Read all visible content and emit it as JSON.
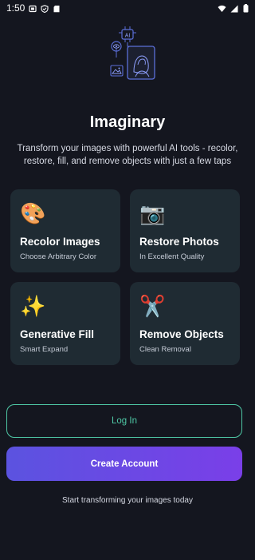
{
  "status_bar": {
    "time": "1:50",
    "icons": [
      "screen-record-icon",
      "vpn-shield-icon",
      "sd-card-icon",
      "wifi-icon",
      "signal-icon",
      "battery-icon"
    ]
  },
  "hero": {
    "badge_text": "AI",
    "icon": "ai-portrait-illustration-icon"
  },
  "app_title": "Imaginary",
  "subtitle": "Transform your images with powerful AI tools - recolor, restore, fill, and remove objects with just a few taps",
  "features": [
    {
      "emoji": "🎨",
      "icon": "palette-icon",
      "title": "Recolor Images",
      "subtitle": "Choose Arbitrary Color"
    },
    {
      "emoji": "📷",
      "icon": "camera-icon",
      "title": "Restore Photos",
      "subtitle": "In Excellent Quality"
    },
    {
      "emoji": "✨",
      "icon": "sparkles-icon",
      "title": "Generative Fill",
      "subtitle": "Smart Expand"
    },
    {
      "emoji": "✂️",
      "icon": "scissors-icon",
      "title": "Remove Objects",
      "subtitle": "Clean Removal"
    }
  ],
  "buttons": {
    "login_label": "Log In",
    "create_account_label": "Create Account"
  },
  "footer": "Start transforming your images today",
  "colors": {
    "background": "#14161f",
    "card": "#1f2b33",
    "accent_teal": "#4fc9a6",
    "gradient_start": "#5b53e0",
    "gradient_end": "#7a3fe8",
    "hero_line": "#5b6fd8"
  }
}
